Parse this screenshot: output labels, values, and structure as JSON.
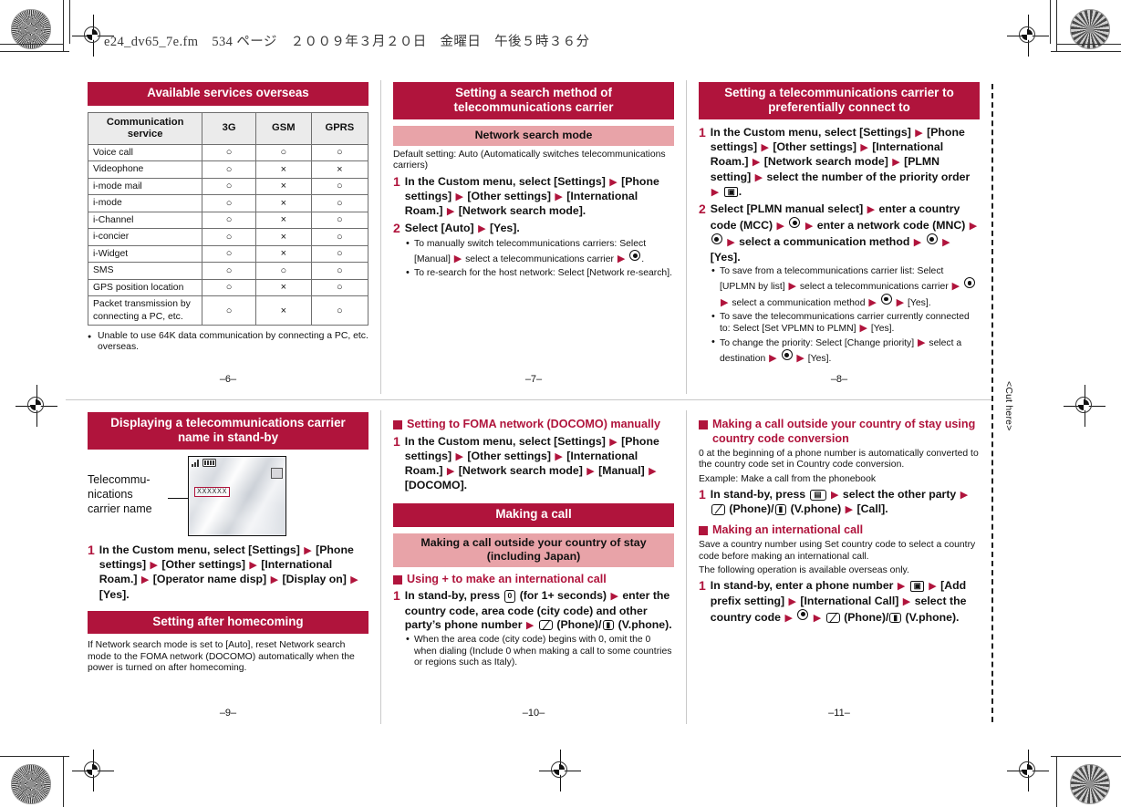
{
  "running_head": "e24_dv65_7e.fm　534 ページ　２００９年３月２０日　金曜日　午後５時３６分",
  "cut_mark_label": "<Cut here>",
  "folios": {
    "p6": "–6–",
    "p7": "–7–",
    "p8": "–8–",
    "p9": "–9–",
    "p10": "–10–",
    "p11": "–11–"
  },
  "colors": {
    "accent_red": "#B0143C",
    "accent_pink": "#E8A3A8",
    "table_header_gray": "#EBEBEB"
  },
  "panels": {
    "available_services": {
      "title": "Available services overseas",
      "table": {
        "columns": [
          "Communication service",
          "3G",
          "GSM",
          "GPRS"
        ],
        "rows": [
          {
            "service": "Voice call",
            "3G": "○",
            "GSM": "○",
            "GPRS": "○"
          },
          {
            "service": "Videophone",
            "3G": "○",
            "GSM": "×",
            "GPRS": "×"
          },
          {
            "service": "i-mode mail",
            "3G": "○",
            "GSM": "×",
            "GPRS": "○"
          },
          {
            "service": "i-mode",
            "3G": "○",
            "GSM": "×",
            "GPRS": "○"
          },
          {
            "service": "i-Channel",
            "3G": "○",
            "GSM": "×",
            "GPRS": "○"
          },
          {
            "service": "i-concier",
            "3G": "○",
            "GSM": "×",
            "GPRS": "○"
          },
          {
            "service": "i-Widget",
            "3G": "○",
            "GSM": "×",
            "GPRS": "○"
          },
          {
            "service": "SMS",
            "3G": "○",
            "GSM": "○",
            "GPRS": "○"
          },
          {
            "service": "GPS position location",
            "3G": "○",
            "GSM": "×",
            "GPRS": "○"
          },
          {
            "service": "Packet transmission by connecting a PC, etc.",
            "3G": "○",
            "GSM": "×",
            "GPRS": "○"
          }
        ]
      },
      "footnote": "Unable to use 64K data communication by connecting a PC, etc. overseas."
    },
    "search_method": {
      "title": "Setting a search method of telecommunications carrier",
      "subhead": "Network search mode",
      "default_note": "Default setting: Auto (Automatically switches telecommunications carriers)",
      "step1_num": "1",
      "step1_a": "In the Custom menu, select [Settings]",
      "step1_b": "[Phone settings]",
      "step1_c": "[Other settings]",
      "step1_d": "[International Roam.]",
      "step1_e": "[Network search mode].",
      "step2_num": "2",
      "step2_a": "Select [Auto]",
      "step2_b": "[Yes].",
      "bullet1_a": "To manually switch telecommunications carriers: Select [Manual]",
      "bullet1_b": "select a telecommunications carrier",
      "bullet1_c": ".",
      "bullet2": "To re-search for the host network: Select [Network re-search]."
    },
    "preferential_carrier": {
      "title": "Setting a telecommunications carrier to preferentially connect to",
      "step1_num": "1",
      "step1_a": "In the Custom menu, select [Settings]",
      "step1_b": "[Phone settings]",
      "step1_c": "[Other settings]",
      "step1_d": "[International Roam.]",
      "step1_e": "[Network search mode]",
      "step1_f": "[PLMN setting]",
      "step1_g": "select the number of the priority order",
      "step1_h": ".",
      "step2_num": "2",
      "step2_a": "Select [PLMN manual select]",
      "step2_b": "enter a country code (MCC)",
      "step2_c": "enter a network code (MNC)",
      "step2_d": "select a communication method",
      "step2_e": "[Yes].",
      "bullet1_a": "To save from a telecommunications carrier list: Select [UPLMN by list]",
      "bullet1_b": "select a telecommunications carrier",
      "bullet1_c": "select a communication method",
      "bullet1_d": "[Yes].",
      "bullet2_a": "To save the telecommunications carrier currently connected to: Select [Set VPLMN to PLMN]",
      "bullet2_b": "[Yes].",
      "bullet3_a": "To change the priority: Select [Change priority]",
      "bullet3_b": "select a destination",
      "bullet3_c": "[Yes]."
    },
    "display_carrier_name": {
      "title": "Displaying a telecommunications carrier name in stand-by",
      "callout": "Telecommu-nications carrier name",
      "screen_carrier_text": "XXXXXX",
      "step1_num": "1",
      "step1_a": "In the Custom menu, select [Settings]",
      "step1_b": "[Phone settings]",
      "step1_c": "[Other settings]",
      "step1_d": "[International Roam.]",
      "step1_e": "[Operator name disp]",
      "step1_f": "[Display on]",
      "step1_g": "[Yes]."
    },
    "after_homecoming": {
      "title": "Setting after homecoming",
      "body": "If Network search mode is set to [Auto], reset Network search mode to the FOMA network (DOCOMO) automatically when the power is turned on after homecoming."
    },
    "foma_manual": {
      "title": "Setting to FOMA network (DOCOMO) manually",
      "step1_num": "1",
      "step1_a": "In the Custom menu, select [Settings]",
      "step1_b": "[Phone settings]",
      "step1_c": "[Other settings]",
      "step1_d": "[International Roam.]",
      "step1_e": "[Network search mode]",
      "step1_f": "[Manual]",
      "step1_g": "[DOCOMO]."
    },
    "making_a_call": {
      "title": "Making a call",
      "subhead": "Making a call outside your country of stay (including Japan)",
      "square_head": "Using + to make an international call",
      "step1_num": "1",
      "step1_a": "In stand-by, press",
      "step1_key": "0",
      "step1_b": "(for 1+ seconds)",
      "step1_c": "enter the country code, area code (city code) and other party’s phone number",
      "step1_d": "(Phone)/",
      "step1_e": "(V.phone).",
      "bullet1": "When the area code (city code) begins with 0, omit the 0 when dialing (Include 0 when making a call to some countries or regions such as Italy)."
    },
    "country_code_conversion": {
      "square_head": "Making a call outside your country of stay using country code conversion",
      "note1": "0 at the beginning of a phone number is automatically converted to the country code set in Country code conversion.",
      "note2": "Example: Make a call from the phonebook",
      "step1_num": "1",
      "step1_a": "In stand-by, press",
      "step1_b": "select the other party",
      "step1_c": "(Phone)/",
      "step1_d": "(V.phone)",
      "step1_e": "[Call]."
    },
    "international_call": {
      "square_head": "Making an international call",
      "note1": "Save a country number using Set country code to select a country code before making an international call.",
      "note2": "The following operation is available overseas only.",
      "step1_num": "1",
      "step1_a": "In stand-by, enter a phone number",
      "step1_b": "[Add prefix setting]",
      "step1_c": "[International Call]",
      "step1_d": "select the country code",
      "step1_e": "(Phone)/",
      "step1_f": "(V.phone)."
    }
  }
}
